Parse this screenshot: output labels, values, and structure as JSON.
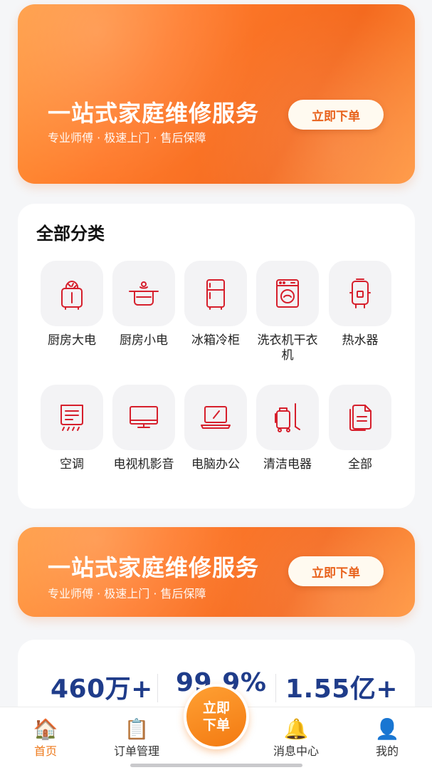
{
  "banner_top": {
    "title": "一站式家庭维修服务",
    "subtitle": "专业师傅 · 极速上门 · 售后保障",
    "button_label": "立即下单"
  },
  "categories": {
    "title": "全部分类",
    "items": [
      {
        "label": "厨房大电",
        "icon": "toaster-icon"
      },
      {
        "label": "厨房小电",
        "icon": "cooking-pot-icon"
      },
      {
        "label": "冰箱冷柜",
        "icon": "fridge-icon"
      },
      {
        "label": "洗衣机干衣机",
        "icon": "washing-machine-icon"
      },
      {
        "label": "热水器",
        "icon": "water-heater-icon"
      },
      {
        "label": "空调",
        "icon": "air-conditioner-icon"
      },
      {
        "label": "电视机影音",
        "icon": "tv-icon"
      },
      {
        "label": "电脑办公",
        "icon": "laptop-icon"
      },
      {
        "label": "清洁电器",
        "icon": "vacuum-icon"
      },
      {
        "label": "全部",
        "icon": "documents-icon"
      }
    ]
  },
  "banner_bottom": {
    "title": "一站式家庭维修服务",
    "subtitle": "专业师傅 · 极速上门 · 售后保障",
    "button_label": "立即下单"
  },
  "stats": {
    "items": [
      "460万+",
      "99.9%",
      "1.55亿+"
    ]
  },
  "tabbar": {
    "items": [
      {
        "label": "首页",
        "icon": "house-icon",
        "active": true
      },
      {
        "label": "订单管理",
        "icon": "clipboard-icon",
        "active": false
      },
      {
        "label": "消息中心",
        "icon": "bell-icon",
        "active": false
      },
      {
        "label": "我的",
        "icon": "user-icon",
        "active": false
      }
    ],
    "center_button": "立即\n下单"
  },
  "colors": {
    "accent": "#f37a12",
    "icon_red": "#d61f2c",
    "stat_blue": "#1f3c8a"
  }
}
